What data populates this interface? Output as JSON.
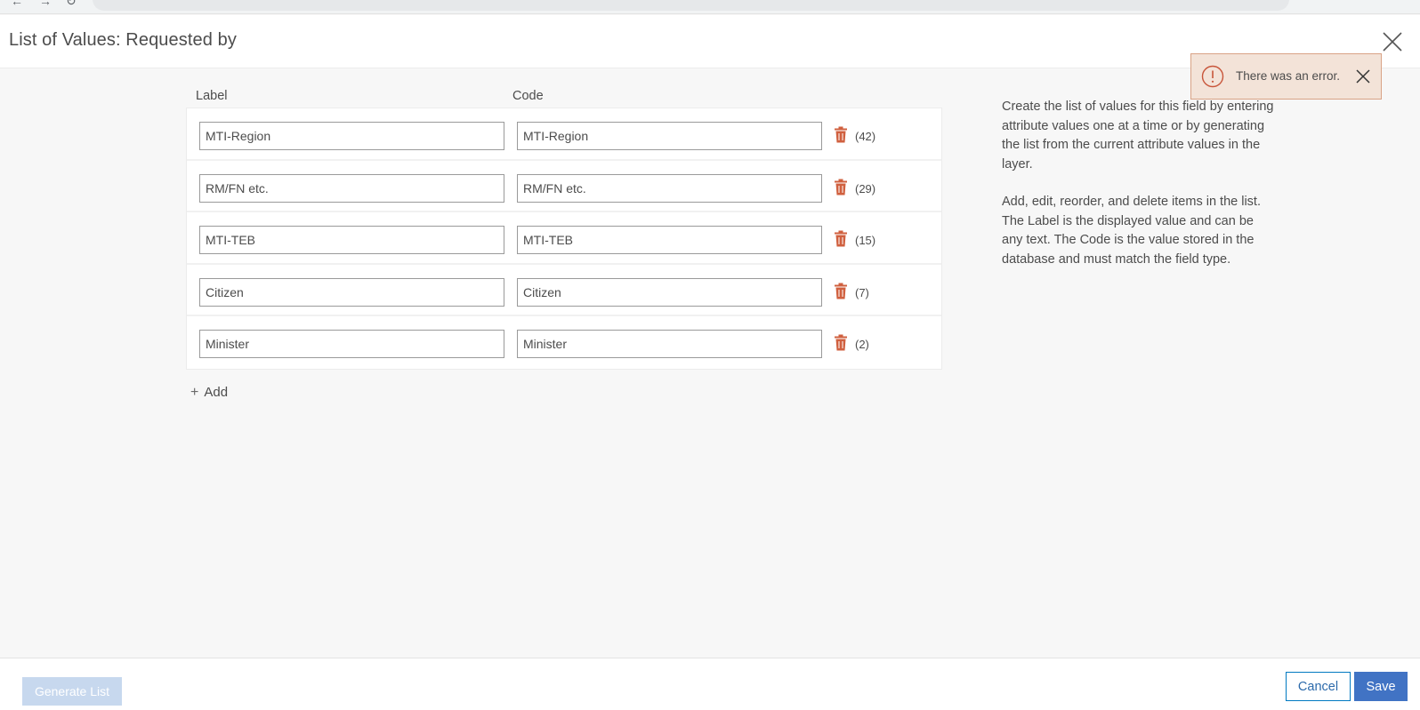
{
  "dialog": {
    "title": "List of Values: Requested by"
  },
  "toast": {
    "message": "There was an error."
  },
  "columns": {
    "label": "Label",
    "code": "Code"
  },
  "rows": [
    {
      "label": "MTI-Region",
      "code": "MTI-Region",
      "count": "(42)"
    },
    {
      "label": "RM/FN etc.",
      "code": "RM/FN etc.",
      "count": "(29)"
    },
    {
      "label": "MTI-TEB",
      "code": "MTI-TEB",
      "count": "(15)"
    },
    {
      "label": "Citizen",
      "code": "Citizen",
      "count": "(7)"
    },
    {
      "label": "Minister",
      "code": "Minister",
      "count": "(2)"
    }
  ],
  "add_label": "Add",
  "help": {
    "paragraph1": "Create the list of values for this field by entering attribute values one at a time or by generating the list from the current attribute values in the layer.",
    "paragraph2": "Add, edit, reorder, and delete items in the list. The Label is the displayed value and can be any text. The Code is the value stored in the database and must match the field type."
  },
  "footer": {
    "generate_label": "Generate List",
    "cancel_label": "Cancel",
    "save_label": "Save"
  },
  "colors": {
    "error_icon": "#c8553a",
    "trash_icon": "#d0603f",
    "primary": "#4173c4",
    "disabled_primary": "#c7d8ee",
    "toast_background": "#f3e3d8"
  },
  "icons": [
    "back-icon",
    "forward-icon",
    "reload-icon",
    "close-icon",
    "error-icon",
    "trash-icon",
    "plus-icon"
  ]
}
